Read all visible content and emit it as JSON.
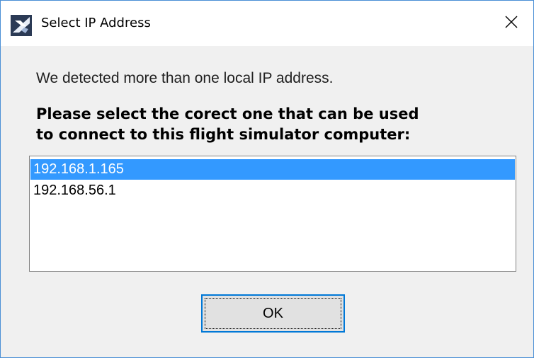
{
  "window": {
    "title": "Select IP Address",
    "icon": "flight-simulator-app-icon",
    "close_icon": "close-icon"
  },
  "dialog": {
    "intro_text": "We detected more than one local IP address.",
    "prompt_line1": "Please select the corect one that can be used",
    "prompt_line2": "to connect to this flight simulator computer:",
    "ip_list": {
      "items": [
        {
          "label": "192.168.1.165",
          "selected": true
        },
        {
          "label": "192.168.56.1",
          "selected": false
        }
      ]
    },
    "ok_label": "OK"
  },
  "colors": {
    "selection": "#3399ff",
    "window_border": "#4a8fd6",
    "button_focus_border": "#0078d7",
    "dialog_background": "#f0f0f0"
  }
}
